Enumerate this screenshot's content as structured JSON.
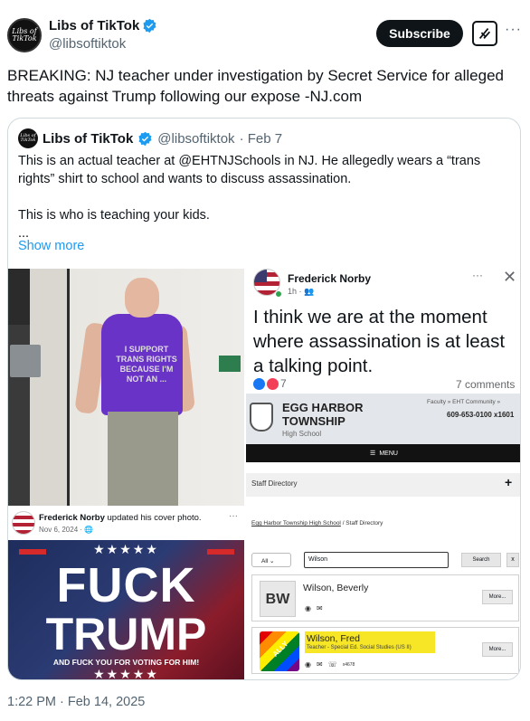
{
  "post": {
    "author_name": "Libs of TikTok",
    "author_handle": "@libsoftiktok",
    "avatar_text": "Libs of TikTok",
    "subscribe_label": "Subscribe",
    "more_label": "···",
    "text": "BREAKING: NJ teacher under investigation by Secret Service for alleged threats against Trump following our expose -NJ.com",
    "timestamp": "1:22 PM · Feb 14, 2025"
  },
  "quote": {
    "author_name": "Libs of TikTok",
    "author_handle": "@libsoftiktok",
    "date": "· Feb 7",
    "text": "This is an actual teacher at @EHTNJSchools in NJ. He allegedly wears a “trans rights” shirt to school and wants to discuss assassination.\n\nThis is who is teaching your kids.\n...",
    "show_more": "Show more"
  },
  "media": {
    "photo": {
      "shirt_text": "I SUPPORT TRANS RIGHTS BECAUSE I'M NOT AN ..."
    },
    "fb_cover": {
      "author": "Frederick Norby",
      "action": "updated his cover photo.",
      "date": "Nov 6, 2024 · ",
      "dots": "···",
      "banner_line1": "FUCK",
      "banner_line2": "TRUMP",
      "banner_line3": "AND FUCK YOU FOR VOTING FOR HIM!",
      "stars": "★★★★★"
    },
    "fb_post": {
      "author": "Frederick Norby",
      "time": "1h · ",
      "dots": "···",
      "close": "✕",
      "text": "I think we are at the moment where assassination is at least a talking point.",
      "reaction_count": "7",
      "comments": "7 comments"
    },
    "school": {
      "name_line1": "EGG HARBOR",
      "name_line2": "TOWNSHIP",
      "subtitle": "High School",
      "links": "Faculty  »  EHT Community  »",
      "phone": "609-653-0100 x1601",
      "menu": "MENU",
      "staff_directory": "Staff Directory",
      "plus": "+",
      "breadcrumb_link": "Egg Harbor Township High School",
      "breadcrumb_rest": " / Staff Directory",
      "filter": "All",
      "search_value": "Wilson",
      "search_button": "Search",
      "clear_button": "x",
      "staff": [
        {
          "initials": "BW",
          "name": "Wilson, Beverly",
          "more": "More..."
        },
        {
          "name": "Wilson, Fred",
          "title": "Teacher - Special Ed. Social Studies (US II)",
          "ext": "x4678",
          "more": "More...",
          "badge": "ALLY"
        }
      ]
    }
  }
}
